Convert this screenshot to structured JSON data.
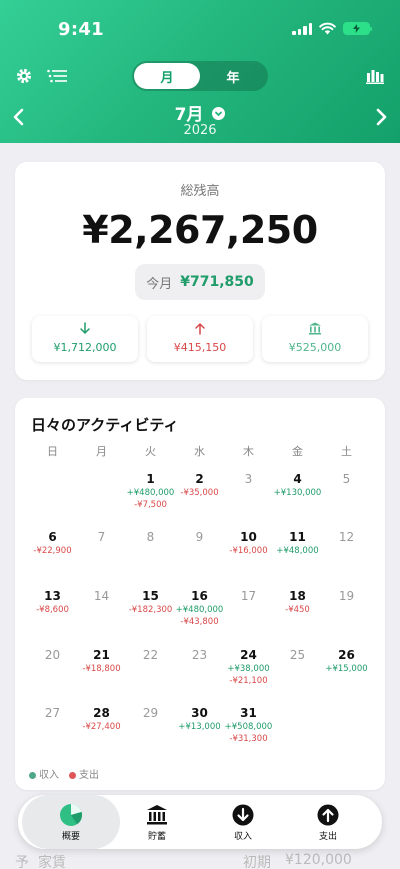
{
  "status": {
    "time": "9:41"
  },
  "toolbar": {
    "segments": [
      "月",
      "年"
    ],
    "active_segment": "月"
  },
  "month_nav": {
    "month": "7月",
    "year": "2026"
  },
  "balance": {
    "label": "総残高",
    "value": "¥2,267,250",
    "month_label": "今月",
    "month_value": "¥771,850",
    "summary": [
      {
        "icon": "arrow-down-icon",
        "value": "¥1,712,000"
      },
      {
        "icon": "arrow-up-icon",
        "value": "¥415,150"
      },
      {
        "icon": "bank-icon",
        "value": "¥525,000"
      }
    ]
  },
  "activity": {
    "title": "日々のアクティビティ",
    "weekdays": [
      "日",
      "月",
      "火",
      "水",
      "木",
      "金",
      "土"
    ],
    "weeks": [
      [
        null,
        null,
        {
          "day": "1",
          "income": "+¥480,000",
          "expense": "-¥7,500"
        },
        {
          "day": "2",
          "income": "",
          "expense": "-¥35,000"
        },
        {
          "day": "3",
          "income": "",
          "expense": ""
        },
        {
          "day": "4",
          "income": "+¥130,000",
          "expense": ""
        },
        {
          "day": "5",
          "income": "",
          "expense": ""
        }
      ],
      [
        {
          "day": "6",
          "income": "",
          "expense": "-¥22,900"
        },
        {
          "day": "7",
          "income": "",
          "expense": ""
        },
        {
          "day": "8",
          "income": "",
          "expense": ""
        },
        {
          "day": "9",
          "income": "",
          "expense": ""
        },
        {
          "day": "10",
          "income": "",
          "expense": "-¥16,000"
        },
        {
          "day": "11",
          "income": "+¥48,000",
          "expense": ""
        },
        {
          "day": "12",
          "income": "",
          "expense": ""
        }
      ],
      [
        {
          "day": "13",
          "income": "",
          "expense": "-¥8,600"
        },
        {
          "day": "14",
          "income": "",
          "expense": ""
        },
        {
          "day": "15",
          "income": "",
          "expense": "-¥182,300"
        },
        {
          "day": "16",
          "income": "+¥480,000",
          "expense": "-¥43,800"
        },
        {
          "day": "17",
          "income": "",
          "expense": ""
        },
        {
          "day": "18",
          "income": "",
          "expense": "-¥450"
        },
        {
          "day": "19",
          "income": "",
          "expense": ""
        }
      ],
      [
        {
          "day": "20",
          "income": "",
          "expense": ""
        },
        {
          "day": "21",
          "income": "",
          "expense": "-¥18,800"
        },
        {
          "day": "22",
          "income": "",
          "expense": ""
        },
        {
          "day": "23",
          "income": "",
          "expense": ""
        },
        {
          "day": "24",
          "income": "+¥38,000",
          "expense": "-¥21,100"
        },
        {
          "day": "25",
          "income": "",
          "expense": ""
        },
        {
          "day": "26",
          "income": "+¥15,000",
          "expense": ""
        }
      ],
      [
        {
          "day": "27",
          "income": "",
          "expense": ""
        },
        {
          "day": "28",
          "income": "",
          "expense": "-¥27,400"
        },
        {
          "day": "29",
          "income": "",
          "expense": ""
        },
        {
          "day": "30",
          "income": "+¥13,000",
          "expense": ""
        },
        {
          "day": "31",
          "income": "+¥508,000",
          "expense": "-¥31,300"
        },
        null,
        null
      ]
    ],
    "legend": {
      "income": "収入",
      "expense": "支出"
    }
  },
  "peek": {
    "left": "予",
    "label": "家賃",
    "mid": "初期",
    "value": "¥120,000"
  },
  "tabs": [
    {
      "label": "概要",
      "icon": "pie-chart-icon",
      "active": true
    },
    {
      "label": "貯蓄",
      "icon": "bank-icon",
      "active": false
    },
    {
      "label": "収入",
      "icon": "arrow-down-circle-icon",
      "active": false
    },
    {
      "label": "支出",
      "icon": "arrow-up-circle-icon",
      "active": false
    }
  ],
  "colors": {
    "accent": "#1f9c6a",
    "income": "#1f9c6a",
    "expense": "#d94848",
    "header": "#22b57c"
  }
}
